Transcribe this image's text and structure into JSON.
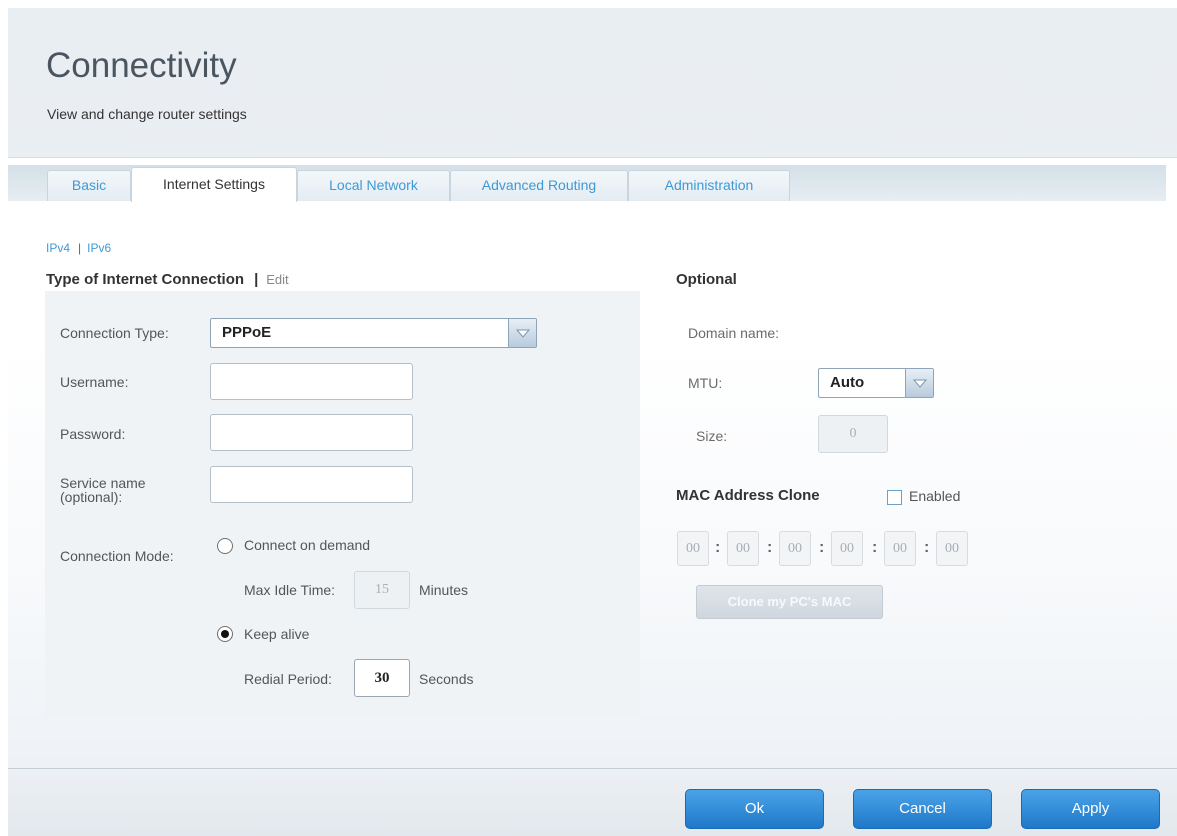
{
  "page": {
    "title": "Connectivity",
    "subtitle": "View and change router settings"
  },
  "tabs": [
    {
      "label": "Basic",
      "active": false
    },
    {
      "label": "Internet Settings",
      "active": true
    },
    {
      "label": "Local Network",
      "active": false
    },
    {
      "label": "Advanced Routing",
      "active": false
    },
    {
      "label": "Administration",
      "active": false
    }
  ],
  "ip_version": {
    "ipv4": "IPv4",
    "separator": "|",
    "ipv6": "IPv6"
  },
  "connection_section": {
    "title": "Type of Internet Connection",
    "separator": "|",
    "edit_label": "Edit",
    "connection_type_label": "Connection Type:",
    "connection_type_value": "PPPoE",
    "username_label": "Username:",
    "username_value": "",
    "password_label": "Password:",
    "password_value": "",
    "service_name_label_1": "Service name",
    "service_name_label_2": "(optional):",
    "service_name_value": "",
    "connection_mode_label": "Connection Mode:",
    "connect_on_demand_label": "Connect on demand",
    "connect_on_demand_selected": false,
    "max_idle_label": "Max Idle Time:",
    "max_idle_value": "15",
    "max_idle_unit": "Minutes",
    "keep_alive_label": "Keep alive",
    "keep_alive_selected": true,
    "redial_label": "Redial Period:",
    "redial_value": "30",
    "redial_unit": "Seconds"
  },
  "optional_section": {
    "title": "Optional",
    "domain_name_label": "Domain name:",
    "mtu_label": "MTU:",
    "mtu_value": "Auto",
    "size_label": "Size:",
    "size_value": "0"
  },
  "mac_clone": {
    "title": "MAC Address Clone",
    "enabled_label": "Enabled",
    "enabled": false,
    "segments": [
      "00",
      "00",
      "00",
      "00",
      "00",
      "00"
    ],
    "separator": ":",
    "clone_button": "Clone my PC's MAC"
  },
  "footer": {
    "ok_label": "Ok",
    "cancel_label": "Cancel",
    "apply_label": "Apply"
  },
  "colors": {
    "accent_blue": "#3e9ad6",
    "button_blue": "#2a86d4"
  }
}
